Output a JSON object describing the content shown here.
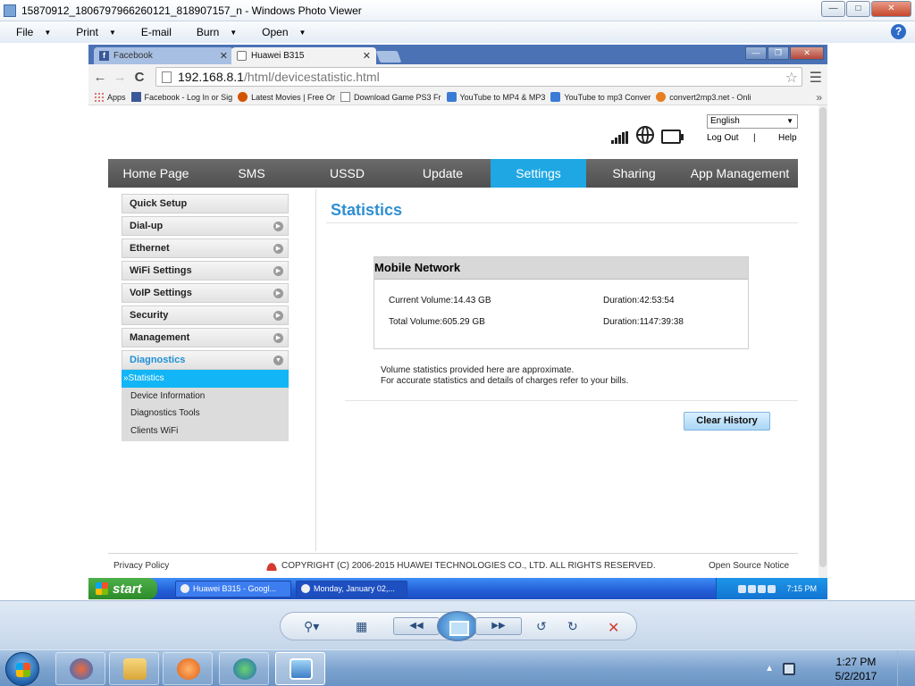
{
  "photo_viewer": {
    "title": "15870912_1806797966260121_818907157_n - Windows Photo Viewer",
    "menus": [
      "File",
      "Print",
      "E-mail",
      "Burn",
      "Open"
    ]
  },
  "browser": {
    "tabs": [
      {
        "label": "Facebook",
        "icon": "facebook-icon",
        "active": false
      },
      {
        "label": "Huawei B315",
        "icon": "huawei-page-icon",
        "active": true
      }
    ],
    "url": {
      "host": "192.168.8.1",
      "path": "/html/devicestatistic.html"
    },
    "bookmarks": [
      {
        "label": "Apps",
        "icon": "apps-icon"
      },
      {
        "label": "Facebook - Log In or Sig",
        "icon": "facebook-icon"
      },
      {
        "label": "Latest Movies | Free Or",
        "icon": "movie-icon"
      },
      {
        "label": "Download Game PS3 Fr",
        "icon": "document-icon"
      },
      {
        "label": "YouTube to MP4 & MP3",
        "icon": "youtube-icon"
      },
      {
        "label": "YouTube to mp3 Conver",
        "icon": "youtube-icon"
      },
      {
        "label": "convert2mp3.net - Onli",
        "icon": "mp3-icon"
      }
    ]
  },
  "router": {
    "language": "English",
    "logout": "Log Out",
    "separator": "|",
    "help": "Help",
    "nav": [
      {
        "label": "Home Page",
        "width": 107
      },
      {
        "label": "SMS",
        "width": 107
      },
      {
        "label": "USSD",
        "width": 107
      },
      {
        "label": "Update",
        "width": 107
      },
      {
        "label": "Settings",
        "width": 107,
        "active": true
      },
      {
        "label": "Sharing",
        "width": 107
      },
      {
        "label": "App Management",
        "width": 130
      }
    ],
    "sidebar": [
      {
        "label": "Quick Setup",
        "arrow": false
      },
      {
        "label": "Dial-up",
        "arrow": true
      },
      {
        "label": "Ethernet",
        "arrow": true
      },
      {
        "label": "WiFi Settings",
        "arrow": true
      },
      {
        "label": "VoIP Settings",
        "arrow": true
      },
      {
        "label": "Security",
        "arrow": true
      },
      {
        "label": "Management",
        "arrow": true
      },
      {
        "label": "Diagnostics",
        "arrow": true,
        "open": true
      }
    ],
    "submenu": [
      {
        "label": "»Statistics",
        "active": true
      },
      {
        "label": "Device Information"
      },
      {
        "label": "Diagnostics Tools"
      },
      {
        "label": "Clients WiFi"
      }
    ],
    "content": {
      "title": "Statistics",
      "box_title": "Mobile Network",
      "current_volume": "Current Volume:14.43 GB",
      "current_duration": "Duration:42:53:54",
      "total_volume": "Total Volume:605.29 GB",
      "total_duration": "Duration:1147:39:38",
      "note_line1": "Volume statistics provided here are approximate.",
      "note_line2": "For accurate statistics and details of charges refer to your bills.",
      "clear_button": "Clear History"
    },
    "footer": {
      "privacy": "Privacy Policy",
      "copyright": "COPYRIGHT (C) 2006-2015 HUAWEI TECHNOLOGIES CO., LTD. ALL RIGHTS RESERVED.",
      "open_source": "Open Source Notice"
    }
  },
  "xp_taskbar": {
    "start": "start",
    "tasks": [
      "Huawei B315 - Googl...",
      "Monday, January 02,..."
    ],
    "time": "7:15 PM"
  },
  "windows_taskbar": {
    "time": "1:27 PM",
    "date": "5/2/2017"
  }
}
